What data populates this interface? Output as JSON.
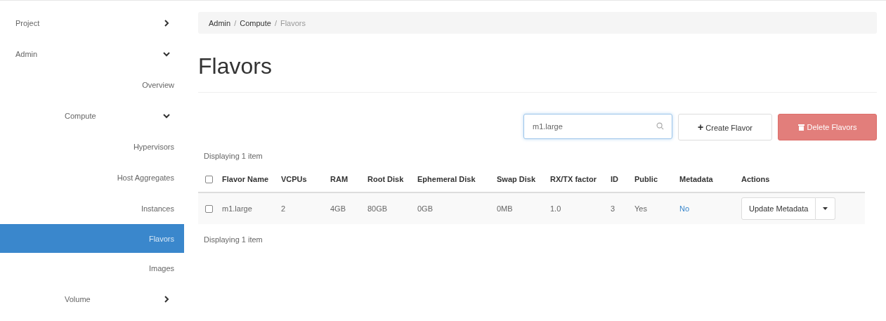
{
  "sidebar": {
    "items": [
      {
        "kind": "section",
        "label": "Project",
        "expanded": false
      },
      {
        "kind": "section",
        "label": "Admin",
        "expanded": true,
        "children": [
          {
            "label": "Overview",
            "selected": false
          },
          {
            "kind": "section",
            "label": "Compute",
            "expanded": true,
            "children": [
              {
                "label": "Hypervisors",
                "selected": false
              },
              {
                "label": "Host Aggregates",
                "selected": false
              },
              {
                "label": "Instances",
                "selected": false
              },
              {
                "label": "Flavors",
                "selected": true
              },
              {
                "label": "Images",
                "selected": false
              }
            ]
          },
          {
            "kind": "section",
            "label": "Volume",
            "expanded": false
          }
        ]
      }
    ]
  },
  "breadcrumb": [
    "Admin",
    "Compute",
    "Flavors"
  ],
  "breadcrumb_separator": "/",
  "page_title": "Flavors",
  "toolbar": {
    "search": {
      "value": "m1.large"
    },
    "create_button": {
      "icon": "+",
      "label": "Create Flavor"
    },
    "delete_button": {
      "label": "Delete Flavors",
      "disabled": true
    }
  },
  "table": {
    "summary_top": "Displaying 1 item",
    "summary_bottom": "Displaying 1 item",
    "select_all_checked": false,
    "columns": [
      "Flavor Name",
      "VCPUs",
      "RAM",
      "Root Disk",
      "Ephemeral Disk",
      "Swap Disk",
      "RX/TX factor",
      "ID",
      "Public",
      "Metadata",
      "Actions"
    ],
    "rows": [
      {
        "checked": false,
        "cells": [
          "m1.large",
          "2",
          "4GB",
          "80GB",
          "0GB",
          "0MB",
          "1.0",
          "3",
          "Yes"
        ],
        "metadata": "No",
        "action": "Update Metadata"
      }
    ]
  }
}
